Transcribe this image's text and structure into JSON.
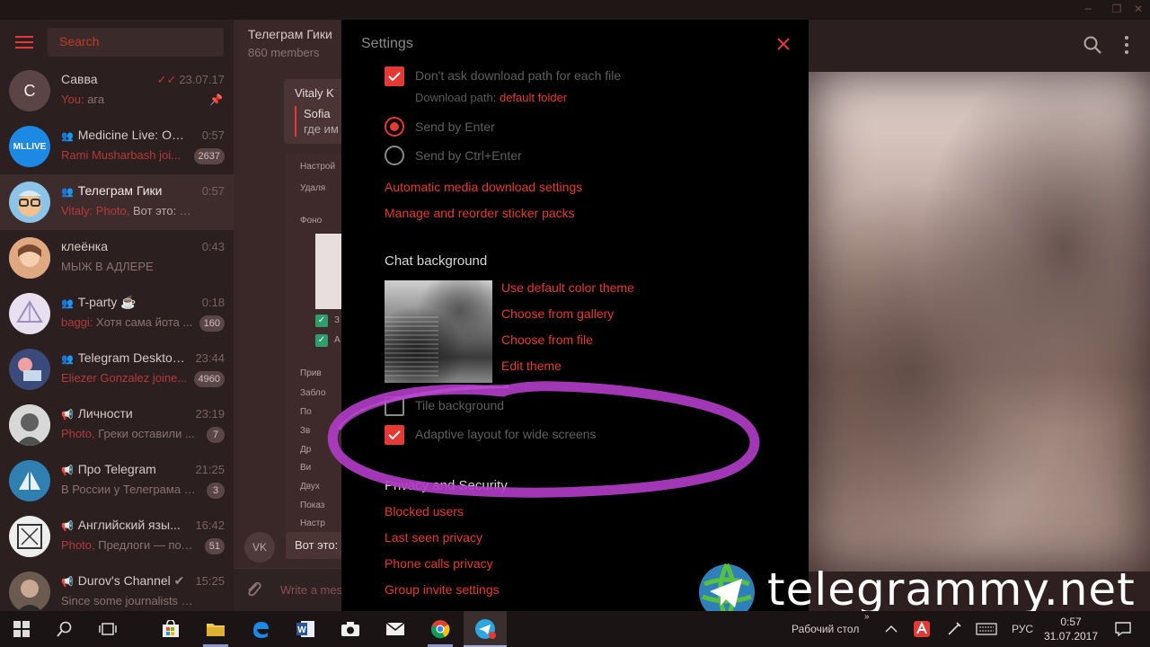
{
  "sidebar": {
    "search_placeholder": "Search",
    "chats": [
      {
        "name": "Савва",
        "time": "23.07.17",
        "who": "You:",
        "preview": "ага",
        "avatar_letter": "С",
        "avatar_color": "#5a4444"
      },
      {
        "name": "Medicine Live: Общ...",
        "time": "0:57",
        "who": "Rami Musharbash joi...",
        "preview": "",
        "badge": "2637",
        "avatar_text": "MLLIVE",
        "avatar_color": "#1e88e5"
      },
      {
        "name": "Телеграм Гики",
        "time": "0:57",
        "who": "Vitaly: Photo,",
        "preview": "Вот это: Альте...",
        "avatar_color": "#8cc4e8"
      },
      {
        "name": "клеёнка",
        "time": "0:43",
        "who": "",
        "preview": "МЫЖ В АДЛЕРЕ",
        "avatar_color": "#c89070"
      },
      {
        "name": "T-party ☕",
        "time": "0:18",
        "who": "baggi:",
        "preview": "Хотя сама йота ...",
        "badge": "160",
        "avatar_color": "#e8e0ee"
      },
      {
        "name": "Telegram Desktop...",
        "time": "23:44",
        "who": "Eliezer Gonzalez joine...",
        "preview": "",
        "badge": "4960",
        "avatar_color": "#3a4a7a"
      },
      {
        "name": "Личности",
        "time": "23:19",
        "who": "Photo,",
        "preview": "Греки оставили ...",
        "badge": "7",
        "avatar_color": "#7a7a7a"
      },
      {
        "name": "Про Telegram",
        "time": "21:25",
        "who": "",
        "preview": "В России у Телеграма н...",
        "badge": "3",
        "avatar_color": "#2f7fb0"
      },
      {
        "name": "Английский язы...",
        "time": "16:42",
        "who": "Photo,",
        "preview": "Предлоги — пол...",
        "badge": "51",
        "avatar_color": "#eeeeee"
      },
      {
        "name": "Durov's Channel",
        "time": "15:25",
        "who": "",
        "preview": "Since some journalists don't ...",
        "avatar_color": "#6a5a50"
      }
    ]
  },
  "middle": {
    "title": "Телеграм Гики",
    "subtitle": "860 members",
    "bubble_name": "Vitaly K",
    "quote_name": "Sofia",
    "quote_text": "где им",
    "shot_lines": [
      "Настрой",
      "Удаля",
      "Фоно",
      "З",
      "А",
      "Прив",
      "Забло",
      "По",
      "Зв",
      "Др",
      "Ви",
      "Двух",
      "Показ",
      "Настр"
    ],
    "vk_initials": "VK",
    "vk_message": "Вот это: А",
    "composer_placeholder": "Write a message..."
  },
  "settings": {
    "title": "Settings",
    "opt_download_path": "Don't ask download path for each file",
    "download_path_label": "Download path:",
    "download_path_value": "default folder",
    "opt_send_enter": "Send by Enter",
    "opt_send_ctrl_enter": "Send by Ctrl+Enter",
    "link_media": "Automatic media download settings",
    "link_stickers": "Manage and reorder sticker packs",
    "section_background": "Chat background",
    "link_default_theme": "Use default color theme",
    "link_gallery": "Choose from gallery",
    "link_file": "Choose from file",
    "link_edit_theme": "Edit theme",
    "opt_tile": "Tile background",
    "opt_adaptive": "Adaptive layout for wide screens",
    "section_privacy": "Privacy and Security",
    "link_blocked": "Blocked users",
    "link_last_seen": "Last seen privacy",
    "link_calls": "Phone calls privacy",
    "link_group_invite": "Group invite settings"
  },
  "watermark": "telegrammy.net",
  "taskbar": {
    "desktop_label": "Рабочий стол",
    "lang": "РУС",
    "time": "0:57",
    "date": "31.07.2017"
  },
  "colors": {
    "accent": "#e53935",
    "modal_bg": "#000000",
    "scribble": "#b03cc4"
  }
}
